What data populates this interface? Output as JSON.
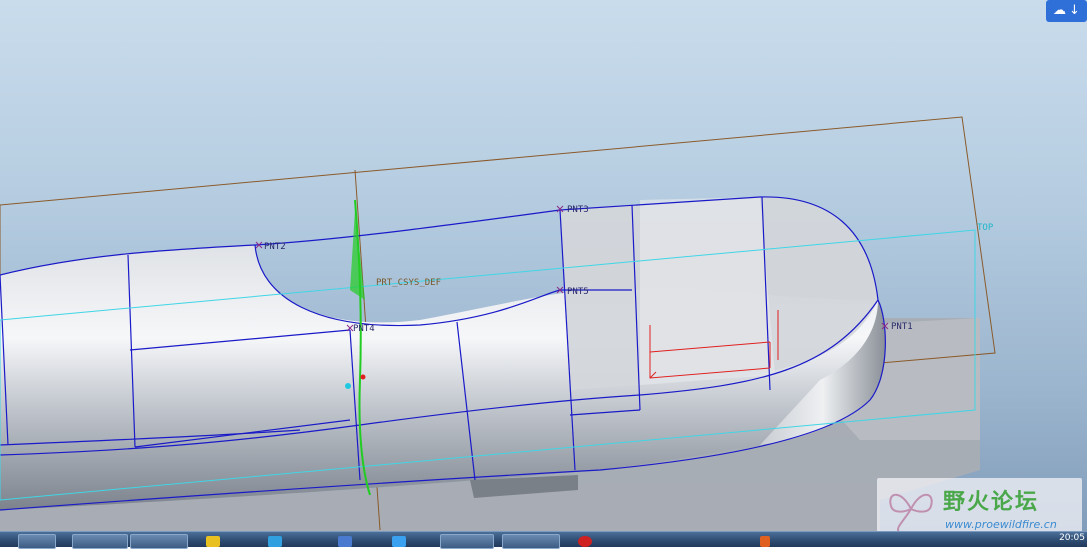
{
  "viewport": {
    "datum_points": [
      "PNT1",
      "PNT2",
      "PNT3",
      "PNT4",
      "PNT5"
    ],
    "datum_plane": "TOP",
    "csys": "PRT_CSYS_DEF"
  },
  "toolbar": {
    "view_icon": "cloud-sync-icon",
    "dropdown_icon": "arrow-down-icon"
  },
  "watermark": {
    "title": "野火论坛",
    "url": "www.proewildfire.cn"
  },
  "taskbar": {
    "apps": [
      "start-button",
      "explorer",
      "window",
      "game",
      "ie",
      "arrow",
      "cloud",
      "window2",
      "monitor",
      "stop"
    ],
    "clock": "20:05"
  },
  "colors": {
    "edge": "#1a1ac8",
    "datum_plane_cyan": "#3fd6e6",
    "sketch_plane_brown": "#8a5a2a",
    "csys_red": "#e02020",
    "green_curve": "#22cc22"
  }
}
